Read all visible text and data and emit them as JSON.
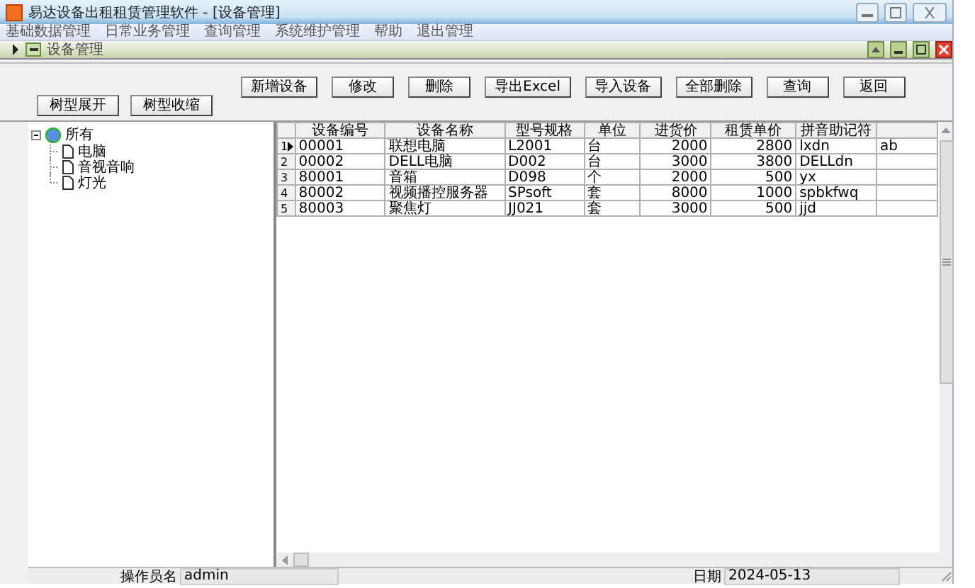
{
  "window": {
    "title": "易达设备出租租赁管理软件 - [设备管理]"
  },
  "menu": [
    "基础数据管理",
    "日常业务管理",
    "查询管理",
    "系统维护管理",
    "帮助",
    "退出管理"
  ],
  "child_window": {
    "title": "设备管理"
  },
  "tree_buttons": [
    "树型展开",
    "树型收缩"
  ],
  "actions": [
    "新增设备",
    "修改",
    "删除",
    "导出Excel",
    "导入设备",
    "全部删除",
    "查询",
    "返回"
  ],
  "tree": {
    "label": "所有",
    "expanded": true,
    "children": [
      {
        "label": "电脑"
      },
      {
        "label": "音视音响"
      },
      {
        "label": "灯光"
      }
    ]
  },
  "table": {
    "columns": [
      "设备编号",
      "设备名称",
      "型号规格",
      "单位",
      "进货价",
      "租赁单价",
      "拼音助记符"
    ],
    "rows": [
      {
        "number": "1",
        "selected": true,
        "cells": [
          "00001",
          "联想电脑",
          "L2001",
          "台",
          "2000",
          "2800",
          "lxdn",
          "ab"
        ]
      },
      {
        "number": "2",
        "selected": false,
        "cells": [
          "00002",
          "DELL电脑",
          "D002",
          "台",
          "3000",
          "3800",
          "DELLdn",
          ""
        ]
      },
      {
        "number": "3",
        "selected": false,
        "cells": [
          "80001",
          "音箱",
          "D098",
          "个",
          "2000",
          "500",
          "yx",
          ""
        ]
      },
      {
        "number": "4",
        "selected": false,
        "cells": [
          "80002",
          "视频播控服务器",
          "SPsoft",
          "套",
          "8000",
          "1000",
          "spbkfwq",
          ""
        ]
      },
      {
        "number": "5",
        "selected": false,
        "cells": [
          "80003",
          "聚焦灯",
          "JJ021",
          "套",
          "3000",
          "500",
          "jjd",
          ""
        ]
      }
    ]
  },
  "status_bar": {
    "operator_label": "操作员名",
    "operator": "admin",
    "date_label": "日期",
    "date": "2024-05-13"
  }
}
